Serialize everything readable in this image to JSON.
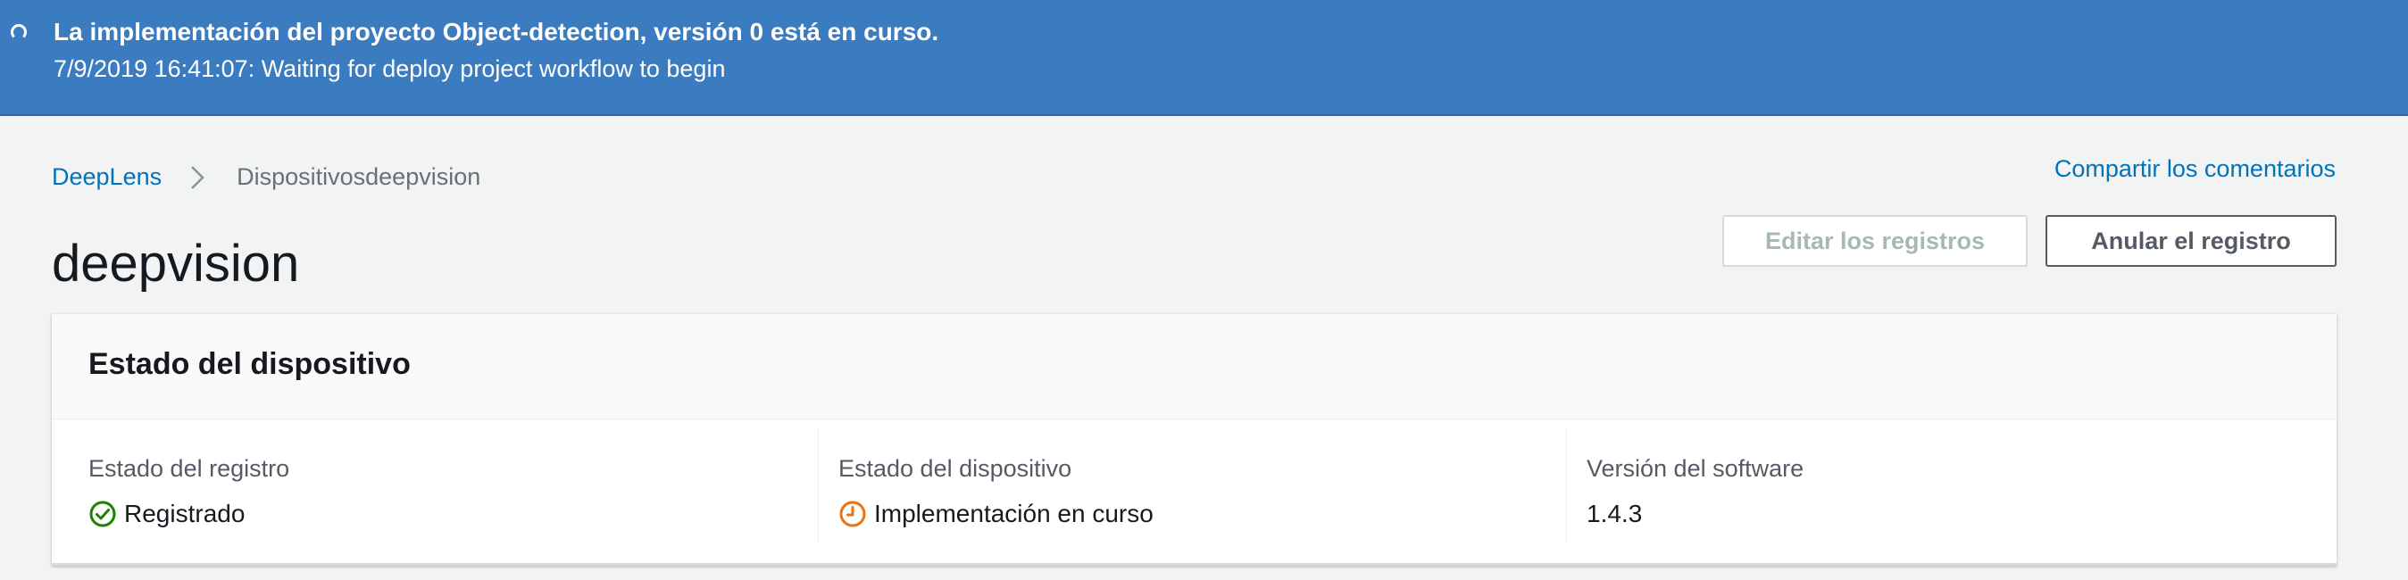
{
  "banner": {
    "title": "La implementación del proyecto Object-detection, versión 0 está en curso.",
    "subtitle": "7/9/2019 16:41:07: Waiting for deploy project workflow to begin",
    "color": "#3b7bbf"
  },
  "breadcrumb": {
    "root": "DeepLens",
    "current": "Dispositivosdeepvision"
  },
  "feedback_link": "Compartir los comentarios",
  "page_title": "deepvision",
  "actions": {
    "edit_label": "Editar los registros",
    "edit_disabled": true,
    "deregister_label": "Anular el registro"
  },
  "device_status": {
    "heading": "Estado del dispositivo",
    "registration": {
      "label": "Estado del registro",
      "value": "Registrado",
      "icon": "check-circle-icon",
      "color": "#1d8102"
    },
    "device": {
      "label": "Estado del dispositivo",
      "value": "Implementación en curso",
      "icon": "clock-icon",
      "color": "#ec7211"
    },
    "software": {
      "label": "Versión del software",
      "value": "1.4.3"
    }
  }
}
